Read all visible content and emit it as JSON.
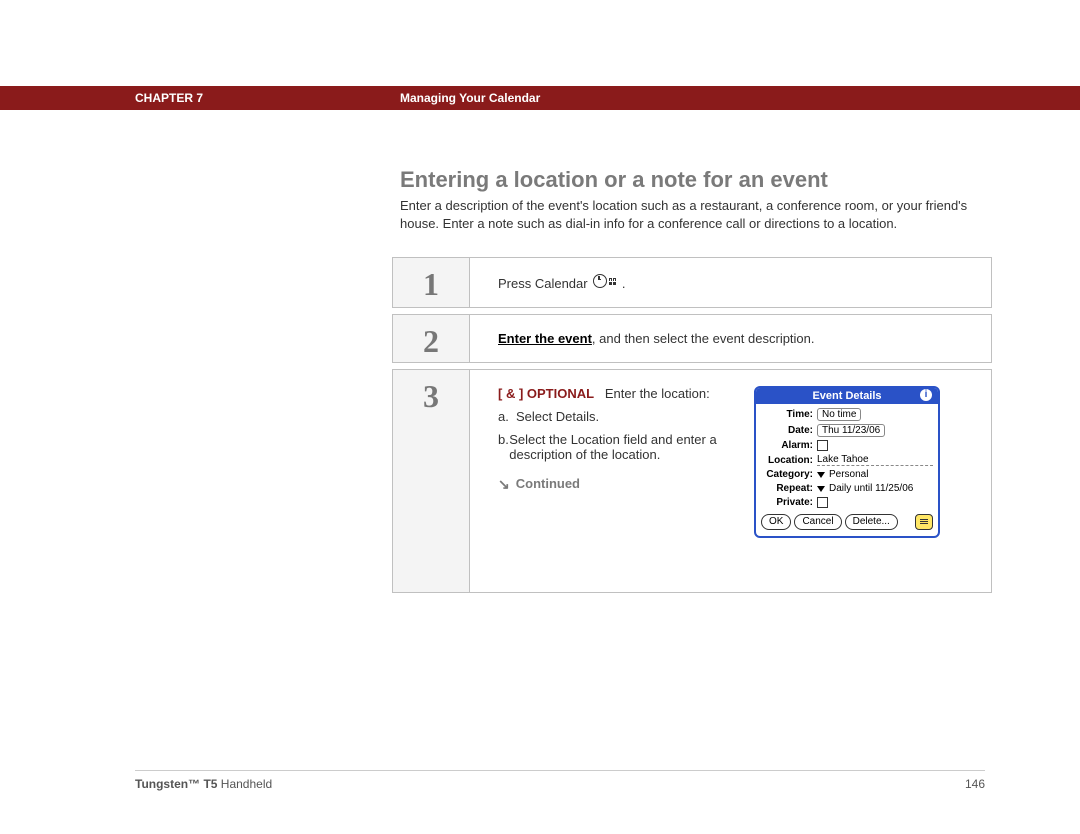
{
  "header": {
    "chapter": "CHAPTER 7",
    "title": "Managing Your Calendar"
  },
  "section_heading": "Entering a location or a note for an event",
  "intro": "Enter a description of the event's location such as a restaurant, a conference room, or your friend's house. Enter a note such as dial-in info for a conference call or directions to a location.",
  "steps": {
    "s1": {
      "num": "1",
      "text_before": "Press Calendar ",
      "text_after": "."
    },
    "s2": {
      "num": "2",
      "link": "Enter the event",
      "rest": ", and then select the event description."
    },
    "s3": {
      "num": "3",
      "optional_label": "[ & ] OPTIONAL",
      "optional_text": "Enter the location:",
      "items": {
        "a_marker": "a.",
        "a_text": "Select Details.",
        "b_marker": "b.",
        "b_text": "Select the Location field and enter a description of the location."
      },
      "continued": "Continued"
    }
  },
  "palm": {
    "title": "Event Details",
    "time_label": "Time:",
    "time_value": "No time",
    "date_label": "Date:",
    "date_value": "Thu 11/23/06",
    "alarm_label": "Alarm:",
    "location_label": "Location:",
    "location_value": "Lake Tahoe",
    "category_label": "Category:",
    "category_value": "Personal",
    "repeat_label": "Repeat:",
    "repeat_value": "Daily until 11/25/06",
    "private_label": "Private:",
    "buttons": {
      "ok": "OK",
      "cancel": "Cancel",
      "delete": "Delete..."
    }
  },
  "footer": {
    "product_bold": "Tungsten™ T5",
    "product_rest": " Handheld",
    "page": "146"
  }
}
